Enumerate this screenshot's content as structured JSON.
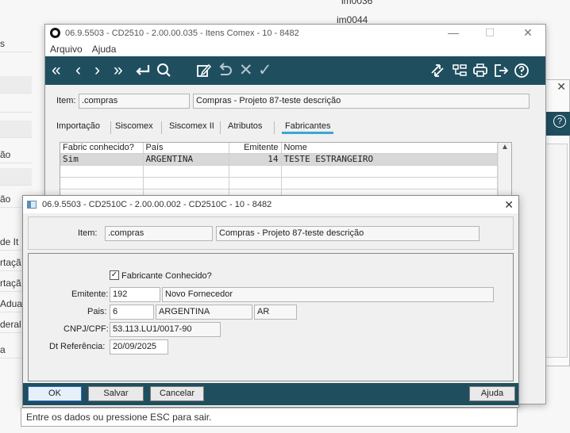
{
  "background": {
    "top_cells": [
      "im0036",
      "im0044"
    ],
    "rows": [
      "s",
      "ão",
      "ão",
      "de It",
      "rtaçã",
      "rtaçã",
      "Adua",
      "deral",
      "a"
    ]
  },
  "main_window": {
    "title": "06.9.5503 - CD2510 - 2.00.00.035 - Itens Comex - 10 - 8482",
    "menu": [
      "Arquivo",
      "Ajuda"
    ],
    "item_label": "Item:",
    "item_value": ".compras",
    "item_description": "Compras - Projeto 87-teste descrição",
    "tabs": [
      "Importação",
      "Siscomex",
      "Siscomex II",
      "Atributos",
      "Fabricantes"
    ],
    "active_tab": "Fabricantes",
    "grid": {
      "columns": [
        "Fabric conhecido?",
        "País",
        "Emitente",
        "Nome"
      ],
      "rows": [
        {
          "fabric": "Sim",
          "pais": "ARGENTINA",
          "emitente": "14",
          "nome": "TESTE ESTRANGEIRO"
        }
      ]
    },
    "status_text": "Entre os dados ou pressione ESC para sair."
  },
  "dialog": {
    "title": "06.9.5503 - CD2510C - 2.00.00.002 - CD2510C - 10 - 8482",
    "item_label": "Item:",
    "item_value": ".compras",
    "item_description": "Compras - Projeto 87-teste descrição",
    "fabricante_label": "Fabricante Conhecido?",
    "fabricante_checked": true,
    "emitente_label": "Emitente:",
    "emitente_code": "192",
    "emitente_name": "Novo Fornecedor",
    "pais_label": "Pais:",
    "pais_code": "6",
    "pais_name": "ARGENTINA",
    "pais_sigla": "AR",
    "cnpj_label": "CNPJ/CPF:",
    "cnpj_value": "53.113.LU1/0017-90",
    "dt_label": "Dt Referência:",
    "dt_value": "20/09/2025",
    "buttons": {
      "ok": "OK",
      "salvar": "Salvar",
      "cancelar": "Cancelar",
      "ajuda": "Ajuda"
    }
  },
  "colors": {
    "toolbar": "#1f4e5f",
    "tab_underline": "#3aa6d5",
    "selected_row": "#d8d8d8"
  }
}
